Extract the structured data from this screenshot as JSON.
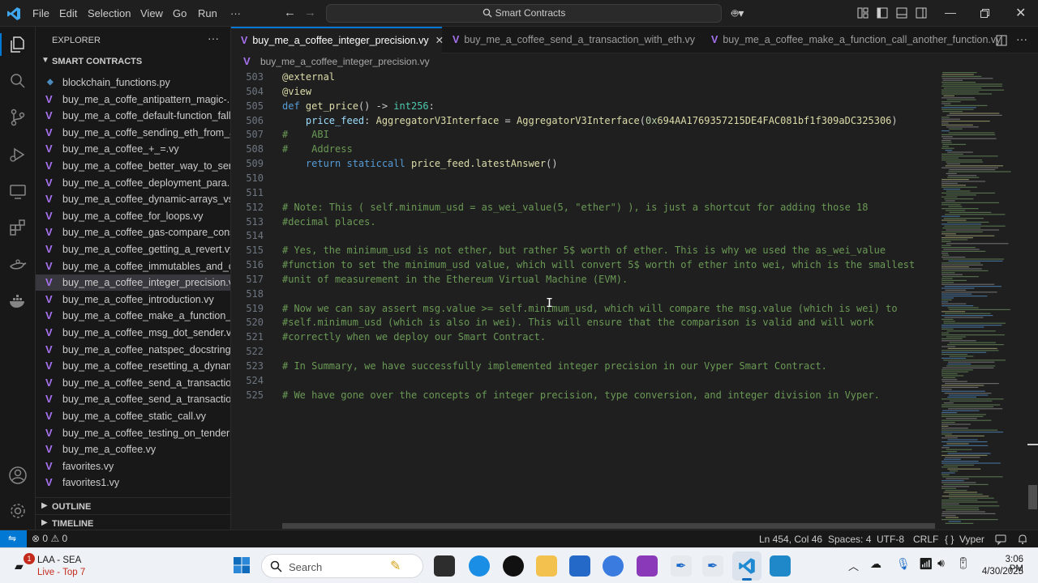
{
  "titlebar": {
    "menu": [
      "File",
      "Edit",
      "Selection",
      "View",
      "Go",
      "Run"
    ],
    "more": "···",
    "search_text": "Smart Contracts"
  },
  "explorer": {
    "title": "EXPLORER",
    "more": "···",
    "folder": "SMART CONTRACTS",
    "files": [
      {
        "label": "blockchain_functions.py",
        "icon": "python-file-icon"
      },
      {
        "label": "buy_me_a_coffe_antipattern_magic-...",
        "icon": "vyper-file-icon"
      },
      {
        "label": "buy_me_a_coffe_default-function_fall...",
        "icon": "vyper-file-icon"
      },
      {
        "label": "buy_me_a_coffe_sending_eth_from_a...",
        "icon": "vyper-file-icon"
      },
      {
        "label": "buy_me_a_coffee_+_=.vy",
        "icon": "vyper-file-icon"
      },
      {
        "label": "buy_me_a_coffee_better_way_to_sen...",
        "icon": "vyper-file-icon"
      },
      {
        "label": "buy_me_a_coffee_deployment_para...",
        "icon": "vyper-file-icon"
      },
      {
        "label": "buy_me_a_coffee_dynamic-arrays_vs...",
        "icon": "vyper-file-icon"
      },
      {
        "label": "buy_me_a_coffee_for_loops.vy",
        "icon": "vyper-file-icon"
      },
      {
        "label": "buy_me_a_coffee_gas-compare_cons...",
        "icon": "vyper-file-icon"
      },
      {
        "label": "buy_me_a_coffee_getting_a_revert.vy",
        "icon": "vyper-file-icon"
      },
      {
        "label": "buy_me_a_coffee_immutables_and_c...",
        "icon": "vyper-file-icon"
      },
      {
        "label": "buy_me_a_coffee_integer_precision.vy",
        "icon": "vyper-file-icon",
        "active": true
      },
      {
        "label": "buy_me_a_coffee_introduction.vy",
        "icon": "vyper-file-icon"
      },
      {
        "label": "buy_me_a_coffee_make_a_function_c...",
        "icon": "vyper-file-icon"
      },
      {
        "label": "buy_me_a_coffee_msg_dot_sender.vy",
        "icon": "vyper-file-icon"
      },
      {
        "label": "buy_me_a_coffee_natspec_docstring...",
        "icon": "vyper-file-icon"
      },
      {
        "label": "buy_me_a_coffee_resetting_a_dynam...",
        "icon": "vyper-file-icon"
      },
      {
        "label": "buy_me_a_coffee_send_a_transaction...",
        "icon": "vyper-file-icon"
      },
      {
        "label": "buy_me_a_coffee_send_a_transaction...",
        "icon": "vyper-file-icon"
      },
      {
        "label": "buy_me_a_coffee_static_call.vy",
        "icon": "vyper-file-icon"
      },
      {
        "label": "buy_me_a_coffee_testing_on_tenderl...",
        "icon": "vyper-file-icon"
      },
      {
        "label": "buy_me_a_coffee.vy",
        "icon": "vyper-file-icon"
      },
      {
        "label": "favorites.vy",
        "icon": "vyper-file-icon"
      },
      {
        "label": "favorites1.vy",
        "icon": "vyper-file-icon"
      }
    ],
    "outline": "OUTLINE",
    "timeline": "TIMELINE"
  },
  "tabs": [
    {
      "label": "buy_me_a_coffee_integer_precision.vy",
      "active": true
    },
    {
      "label": "buy_me_a_coffee_send_a_transaction_with_eth.vy",
      "active": false
    },
    {
      "label": "buy_me_a_coffee_make_a_function_call_another_function.vy",
      "active": false
    }
  ],
  "breadcrumb": "buy_me_a_coffee_integer_precision.vy",
  "code": [
    {
      "ln": "503",
      "segs": [
        [
          "dec",
          "@external"
        ]
      ]
    },
    {
      "ln": "504",
      "segs": [
        [
          "dec",
          "@view"
        ]
      ]
    },
    {
      "ln": "505",
      "segs": [
        [
          "kw",
          "def "
        ],
        [
          "fn",
          "get_price"
        ],
        [
          "",
          "() -> "
        ],
        [
          "ty",
          "int256"
        ],
        [
          "",
          ":"
        ]
      ]
    },
    {
      "ln": "506",
      "segs": [
        [
          "",
          "    "
        ],
        [
          "var",
          "price_feed"
        ],
        [
          "",
          ": "
        ],
        [
          "fn",
          "AggregatorV3Interface"
        ],
        [
          "",
          " = "
        ],
        [
          "fn",
          "AggregatorV3Interface"
        ],
        [
          "",
          "("
        ],
        [
          "num",
          "0x"
        ],
        [
          "fn",
          "694AA1769357215DE4FAC081bf1f309aDC325306"
        ],
        [
          "",
          ")"
        ]
      ]
    },
    {
      "ln": "507",
      "segs": [
        [
          "cm",
          "#    ABI"
        ]
      ]
    },
    {
      "ln": "508",
      "segs": [
        [
          "cm",
          "#    Address"
        ]
      ]
    },
    {
      "ln": "509",
      "segs": [
        [
          "",
          "    "
        ],
        [
          "kw",
          "return "
        ],
        [
          "kw",
          "staticcall "
        ],
        [
          "fn",
          "price_feed.latestAnswer"
        ],
        [
          "",
          "()"
        ]
      ]
    },
    {
      "ln": "510",
      "segs": []
    },
    {
      "ln": "511",
      "segs": []
    },
    {
      "ln": "512",
      "segs": [
        [
          "cm",
          "# Note: This ( self.minimum_usd = as_wei_value(5, \"ether\") ), is just a shortcut for adding those 18"
        ]
      ]
    },
    {
      "ln": "513",
      "segs": [
        [
          "cm",
          "#decimal places."
        ]
      ]
    },
    {
      "ln": "514",
      "segs": []
    },
    {
      "ln": "515",
      "segs": [
        [
          "cm",
          "# Yes, the minimum_usd is not ether, but rather 5$ worth of ether. This is why we used the as_wei_value"
        ]
      ]
    },
    {
      "ln": "516",
      "segs": [
        [
          "cm",
          "#function to set the minimum_usd value, which will convert 5$ worth of ether into wei, which is the smallest"
        ]
      ]
    },
    {
      "ln": "517",
      "segs": [
        [
          "cm",
          "#unit of measurement in the Ethereum Virtual Machine (EVM)."
        ]
      ]
    },
    {
      "ln": "518",
      "segs": []
    },
    {
      "ln": "519",
      "segs": [
        [
          "cm",
          "# Now we can say assert msg.value >= self.minimum_usd, which will compare the msg.value (which is wei) to"
        ]
      ]
    },
    {
      "ln": "520",
      "segs": [
        [
          "cm",
          "#self.minimum_usd (which is also in wei). This will ensure that the comparison is valid and will work"
        ]
      ]
    },
    {
      "ln": "521",
      "segs": [
        [
          "cm",
          "#correctly when we deploy our Smart Contract."
        ]
      ]
    },
    {
      "ln": "522",
      "segs": []
    },
    {
      "ln": "523",
      "segs": [
        [
          "cm",
          "# In Summary, we have successfully implemented integer precision in our Vyper Smart Contract."
        ]
      ]
    },
    {
      "ln": "524",
      "segs": []
    },
    {
      "ln": "525",
      "segs": [
        [
          "cm",
          "# We have gone over the concepts of integer precision, type conversion, and integer division in Vyper."
        ]
      ]
    }
  ],
  "statusbar": {
    "problems": "0",
    "warnings": "0",
    "cursor": "Ln 454, Col 46",
    "spaces": "Spaces: 4",
    "encoding": "UTF-8",
    "eol": "CRLF",
    "language": "Vyper",
    "language_braces": "{ }"
  },
  "taskbar": {
    "weather_title": "LAA - SEA",
    "weather_sub": "Live - Top 7",
    "badge": "1",
    "search": "Search",
    "time": "3:06 PM",
    "date": "4/30/2025"
  },
  "colors": {
    "accent": "#0078d4",
    "vyper": "#a772f0",
    "comment": "#6a9955",
    "keyword": "#569cd6"
  }
}
